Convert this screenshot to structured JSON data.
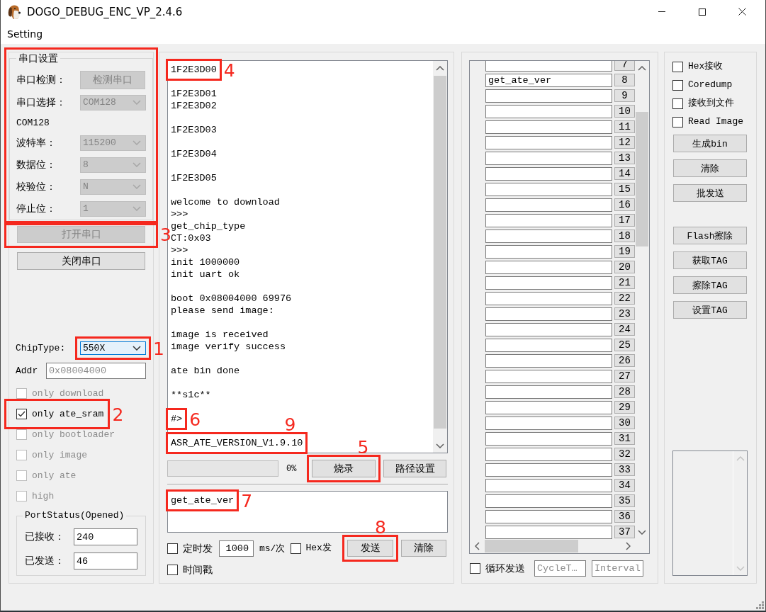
{
  "window": {
    "title": "DOGO_DEBUG_ENC_VP_2.4.6"
  },
  "menu": [
    {
      "label": "Setting"
    }
  ],
  "serial_settings": {
    "title": "串口设置",
    "highlighted": true,
    "fields": [
      {
        "kind": "button",
        "label": "串口检测：",
        "value": "检测串口",
        "disabled": true
      },
      {
        "kind": "select",
        "label": "串口选择：",
        "value": "COM128",
        "disabled": true
      },
      {
        "kind": "text",
        "label": "COM128"
      },
      {
        "kind": "select",
        "label": "波特率：",
        "value": "115200",
        "disabled": true
      },
      {
        "kind": "select",
        "label": "数据位：",
        "value": "8",
        "disabled": true
      },
      {
        "kind": "select",
        "label": "校验位：",
        "value": "N",
        "disabled": true
      },
      {
        "kind": "select",
        "label": "停止位：",
        "value": "1",
        "disabled": true
      }
    ]
  },
  "port_buttons": [
    {
      "label": "打开串口",
      "disabled": true,
      "annotation": {
        "kind": "beside",
        "number": "3"
      }
    },
    {
      "label": "关闭串口",
      "disabled": false
    }
  ],
  "chip_type": {
    "label": "ChipType:",
    "value": "550X",
    "focused": true,
    "annotation": {
      "kind": "beside",
      "number": "1"
    }
  },
  "addr": {
    "label": "Addr",
    "placeholder": "0x08004000"
  },
  "options": [
    {
      "label": "only download",
      "checked": false,
      "disabled": true
    },
    {
      "label": "only ate_sram",
      "checked": true,
      "disabled": false,
      "annotation": {
        "kind": "beside",
        "number": "2"
      }
    },
    {
      "label": "only bootloader",
      "checked": false,
      "disabled": true
    },
    {
      "label": "only image",
      "checked": false,
      "disabled": true
    },
    {
      "label": "only ate",
      "checked": false,
      "disabled": true
    },
    {
      "label": "high",
      "checked": false,
      "disabled": true
    }
  ],
  "port_status": {
    "title": "PortStatus(Opened)",
    "counters": [
      {
        "label": "已接收：",
        "value": "240"
      },
      {
        "label": "已发送：",
        "value": "46"
      }
    ]
  },
  "log": {
    "blocks": [
      [
        {
          "text": "1F2E3D00",
          "annotation": {
            "kind": "beside",
            "number": "4"
          }
        }
      ],
      [
        {
          "text": "1F2E3D01"
        },
        {
          "text": "1F2E3D02"
        }
      ],
      [
        {
          "text": "1F2E3D03"
        }
      ],
      [
        {
          "text": "1F2E3D04"
        }
      ],
      [
        {
          "text": "1F2E3D05"
        }
      ],
      [
        {
          "text": "welcome to download"
        },
        {
          "text": ">>>"
        },
        {
          "text": "get_chip_type"
        },
        {
          "text": "CT:0x03"
        },
        {
          "text": ">>>"
        },
        {
          "text": "init 1000000"
        },
        {
          "text": "init uart ok"
        }
      ],
      [
        {
          "text": "boot 0x08004000 69976"
        },
        {
          "text": "please send image:"
        }
      ],
      [
        {
          "text": "image is received"
        },
        {
          "text": "image verify success"
        }
      ],
      [
        {
          "text": "ate bin done"
        }
      ],
      [
        {
          "text": "**s1c**"
        }
      ],
      [
        {
          "text": "#>",
          "annotation": {
            "kind": "beside",
            "number": "6"
          }
        }
      ],
      [
        {
          "text": "ASR_ATE_VERSION_V1.9.10",
          "annotation": {
            "kind": "above",
            "number": "9"
          }
        }
      ]
    ]
  },
  "burn": {
    "progress": {
      "level": 0,
      "reading": "0%"
    },
    "buttons": [
      {
        "label": "烧录",
        "annotation": {
          "kind": "above",
          "number": "5"
        }
      },
      {
        "label": "路径设置"
      }
    ]
  },
  "send_box": {
    "value": "get_ate_ver",
    "annotation": {
      "kind": "beside",
      "number": "7"
    }
  },
  "send_options": {
    "timer": {
      "label": "定时发",
      "checked": false
    },
    "period": {
      "value": "1000",
      "unit": "ms/次"
    },
    "hex_send": {
      "label": "Hex发",
      "checked": false
    },
    "buttons": [
      {
        "label": "发送",
        "annotation": {
          "kind": "above",
          "number": "8"
        }
      },
      {
        "label": "清除"
      }
    ],
    "timestamp": {
      "label": "时间戳",
      "checked": false
    }
  },
  "command_list": {
    "rows": [
      {
        "number": "7"
      },
      {
        "number": "8",
        "value": "get_ate_ver"
      },
      {
        "number": "9"
      },
      {
        "number": "10"
      },
      {
        "number": "11"
      },
      {
        "number": "12"
      },
      {
        "number": "13"
      },
      {
        "number": "14"
      },
      {
        "number": "15"
      },
      {
        "number": "16"
      },
      {
        "number": "17"
      },
      {
        "number": "18"
      },
      {
        "number": "19"
      },
      {
        "number": "20"
      },
      {
        "number": "21"
      },
      {
        "number": "22"
      },
      {
        "number": "23"
      },
      {
        "number": "24"
      },
      {
        "number": "25"
      },
      {
        "number": "26"
      },
      {
        "number": "27"
      },
      {
        "number": "28"
      },
      {
        "number": "29"
      },
      {
        "number": "30"
      },
      {
        "number": "31"
      },
      {
        "number": "32"
      },
      {
        "number": "33"
      },
      {
        "number": "34"
      },
      {
        "number": "35"
      },
      {
        "number": "36"
      },
      {
        "number": "37"
      }
    ],
    "loop_send": {
      "label": "循环发送",
      "checked": false
    },
    "cycle_field": {
      "placeholder": "CycleT…"
    },
    "interval_field": {
      "placeholder": "Interval"
    }
  },
  "receive_options": [
    {
      "label": "Hex接收",
      "checked": false
    },
    {
      "label": "Coredump",
      "checked": false
    },
    {
      "label": "接收到文件",
      "checked": false
    },
    {
      "label": "Read Image",
      "checked": false
    }
  ],
  "tool_buttons": [
    [
      {
        "label": "生成bin"
      },
      {
        "label": "清除"
      },
      {
        "label": "批发送"
      }
    ],
    [
      {
        "label": "Flash擦除"
      },
      {
        "label": "获取TAG"
      },
      {
        "label": "擦除TAG"
      },
      {
        "label": "设置TAG"
      }
    ]
  ]
}
